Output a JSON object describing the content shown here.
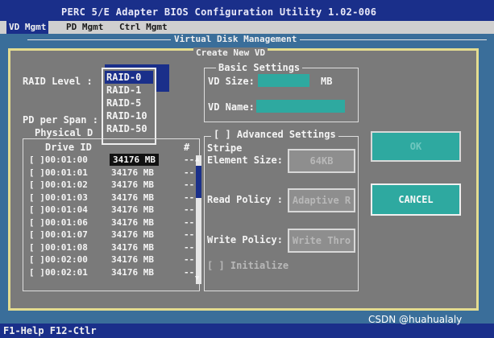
{
  "window": {
    "title": "PERC 5/E Adapter BIOS Configuration Utility 1.02-006"
  },
  "tabs": {
    "vd": "VD Mgmt",
    "pd": "PD Mgmt",
    "ctrl": "Ctrl Mgmt"
  },
  "vdm": {
    "title": "Virtual Disk Management"
  },
  "dialog": {
    "title": "Create New VD",
    "raid_level_label": "RAID Level :",
    "raid_options": [
      "RAID-0",
      "RAID-1",
      "RAID-5",
      "RAID-10",
      "RAID-50"
    ],
    "pd_per_span_label": "PD per Span :",
    "physical_disks_title": "Physical D",
    "drive_id_header": "Drive ID",
    "hash_header": "#",
    "drives": [
      {
        "id": "[ ]00:01:00",
        "size": "34176 MB",
        "sep": "--"
      },
      {
        "id": "[ ]00:01:01",
        "size": "34176 MB",
        "sep": "--"
      },
      {
        "id": "[ ]00:01:02",
        "size": "34176 MB",
        "sep": "--"
      },
      {
        "id": "[ ]00:01:03",
        "size": "34176 MB",
        "sep": "--"
      },
      {
        "id": "[ ]00:01:04",
        "size": "34176 MB",
        "sep": "--"
      },
      {
        "id": "[ ]00:01:06",
        "size": "34176 MB",
        "sep": "--"
      },
      {
        "id": "[ ]00:01:07",
        "size": "34176 MB",
        "sep": "--"
      },
      {
        "id": "[ ]00:01:08",
        "size": "34176 MB",
        "sep": "--"
      },
      {
        "id": "[ ]00:02:00",
        "size": "34176 MB",
        "sep": "--"
      },
      {
        "id": "[ ]00:02:01",
        "size": "34176 MB",
        "sep": "--"
      }
    ],
    "basic_title": "Basic Settings",
    "vd_size_label": "VD Size:",
    "vd_size_value": "",
    "vd_size_unit": "MB",
    "vd_name_label": "VD Name:",
    "vd_name_value": "",
    "advanced_title": "[ ] Advanced Settings",
    "stripe_label": "Stripe",
    "element_size_label": "Element Size:",
    "element_size_value": "64KB",
    "read_policy_label": "Read Policy :",
    "read_policy_value": "Adaptive R",
    "write_policy_label": "Write Policy:",
    "write_policy_value": "Write Thro",
    "initialize_label": "[ ] Initialize",
    "ok_label": "OK",
    "cancel_label": "CANCEL"
  },
  "status": {
    "text": "F1-Help F12-Ctlr"
  },
  "watermark": "CSDN @huahualaly",
  "colors": {
    "title_blue": "#1a2f8a",
    "field_cyan": "#2ea9a0",
    "dialog_gray": "#7a7a7a",
    "border_yellow": "#e4dc90"
  },
  "icons": {
    "scroll_up": "▲",
    "scroll_down": "▼"
  }
}
